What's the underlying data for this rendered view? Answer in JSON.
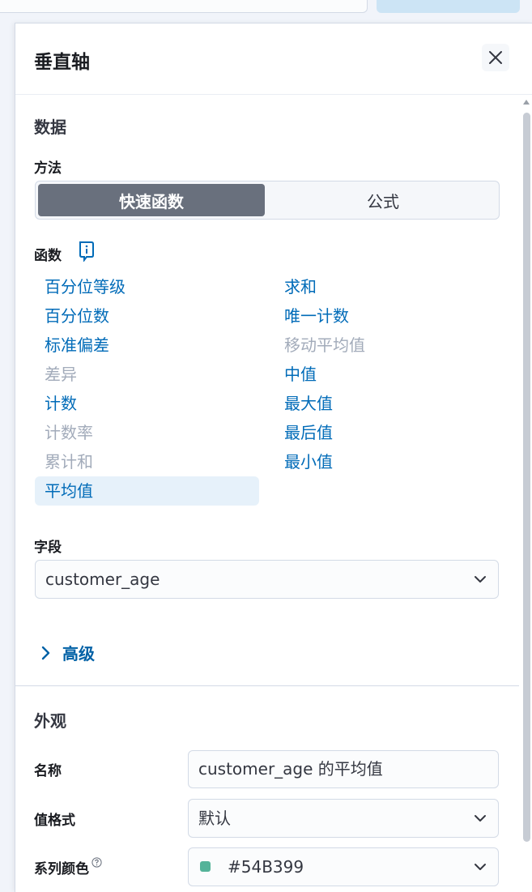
{
  "flyout": {
    "title": "垂直轴"
  },
  "data_section": {
    "heading": "数据",
    "method_label": "方法",
    "methods": [
      "快速函数",
      "公式"
    ],
    "selected_method": "快速函数",
    "function_label": "函数",
    "functions_left": [
      {
        "label": "百分位等级",
        "state": "enabled"
      },
      {
        "label": "百分位数",
        "state": "enabled"
      },
      {
        "label": "标准偏差",
        "state": "enabled"
      },
      {
        "label": "差异",
        "state": "disabled"
      },
      {
        "label": "计数",
        "state": "enabled"
      },
      {
        "label": "计数率",
        "state": "disabled"
      },
      {
        "label": "累计和",
        "state": "disabled"
      },
      {
        "label": "平均值",
        "state": "selected"
      }
    ],
    "functions_right": [
      {
        "label": "求和",
        "state": "enabled"
      },
      {
        "label": "唯一计数",
        "state": "enabled"
      },
      {
        "label": "移动平均值",
        "state": "disabled"
      },
      {
        "label": "中值",
        "state": "enabled"
      },
      {
        "label": "最大值",
        "state": "enabled"
      },
      {
        "label": "最后值",
        "state": "enabled"
      },
      {
        "label": "最小值",
        "state": "enabled"
      }
    ],
    "field_label": "字段",
    "field_value": "customer_age",
    "advanced_label": "高级"
  },
  "appearance_section": {
    "heading": "外观",
    "name_label": "名称",
    "name_value": "customer_age 的平均值",
    "format_label": "值格式",
    "format_value": "默认",
    "color_label": "系列颜色",
    "color_value": "#54B399"
  },
  "colors": {
    "link": "#006bb8",
    "disabled": "#a2abba",
    "selected_bg": "#e6f1fa",
    "active_method_bg": "#69707d",
    "series_color": "#54B399"
  },
  "icons": [
    "close-icon",
    "function-info-icon",
    "chevron-down-icon",
    "chevron-right-icon",
    "question-circle-icon",
    "scroll-up-arrow-icon"
  ]
}
